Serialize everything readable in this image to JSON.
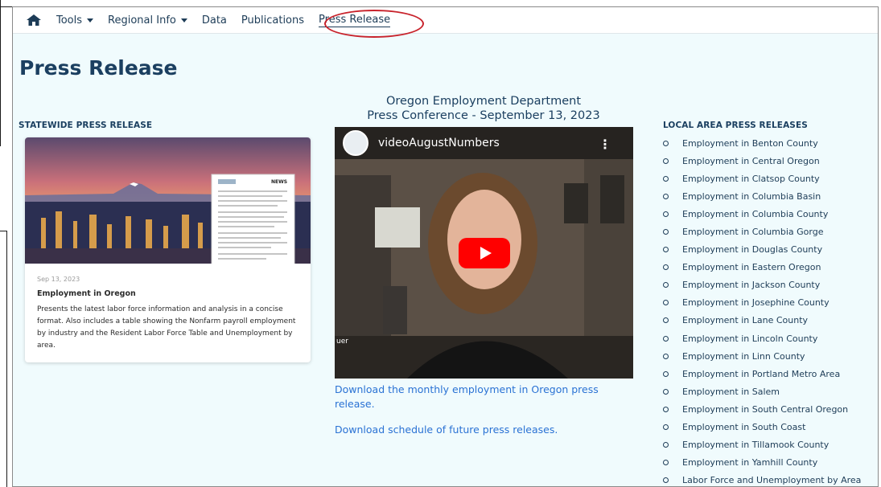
{
  "navbar": {
    "home_icon": "home-icon",
    "items": [
      {
        "label": "Tools",
        "dropdown": true
      },
      {
        "label": "Regional Info",
        "dropdown": true
      },
      {
        "label": "Data",
        "dropdown": false
      },
      {
        "label": "Publications",
        "dropdown": false
      },
      {
        "label": "Press Release",
        "dropdown": false
      }
    ],
    "active": "Press Release",
    "highlight_color": "#c8232c"
  },
  "page": {
    "title": "Press Release"
  },
  "statewide": {
    "heading": "STATEWIDE PRESS RELEASE",
    "card": {
      "date": "Sep 13, 2023",
      "title": "Employment in Oregon",
      "description": "Presents the latest labor force information and analysis in a concise format. Also includes a table showing the Nonfarm payroll employment by industry and the Resident Labor Force Table and Unemployment by area.",
      "thumbnail_badge": "NEWS"
    }
  },
  "video": {
    "heading_line1": "Oregon Employment Department",
    "heading_line2": "Press Conference - September 13, 2023",
    "label": "videoAugustNumbers",
    "caption_fragment": "uer",
    "play_icon": "play-icon",
    "menu_icon": "more-vert-icon"
  },
  "links": {
    "download_monthly": "Download the monthly employment in Oregon press release.",
    "download_schedule": "Download schedule of future press releases."
  },
  "local": {
    "heading": "LOCAL AREA PRESS RELEASES",
    "items": [
      "Employment in Benton County",
      "Employment in Central Oregon",
      "Employment in Clatsop County",
      "Employment in Columbia Basin",
      "Employment in Columbia County",
      "Employment in Columbia Gorge",
      "Employment in Douglas County",
      "Employment in Eastern Oregon",
      "Employment in Jackson County",
      "Employment in Josephine County",
      "Employment in Lane County",
      "Employment in Lincoln County",
      "Employment in Linn County",
      "Employment in Portland Metro Area",
      "Employment in Salem",
      "Employment in South Central Oregon",
      "Employment in South Coast",
      "Employment in Tillamook County",
      "Employment in Yamhill County",
      "Labor Force and Unemployment by Area"
    ]
  },
  "colors": {
    "title": "#1b3f60",
    "link": "#2a72d4",
    "page_bg": "#f0fbfd"
  }
}
